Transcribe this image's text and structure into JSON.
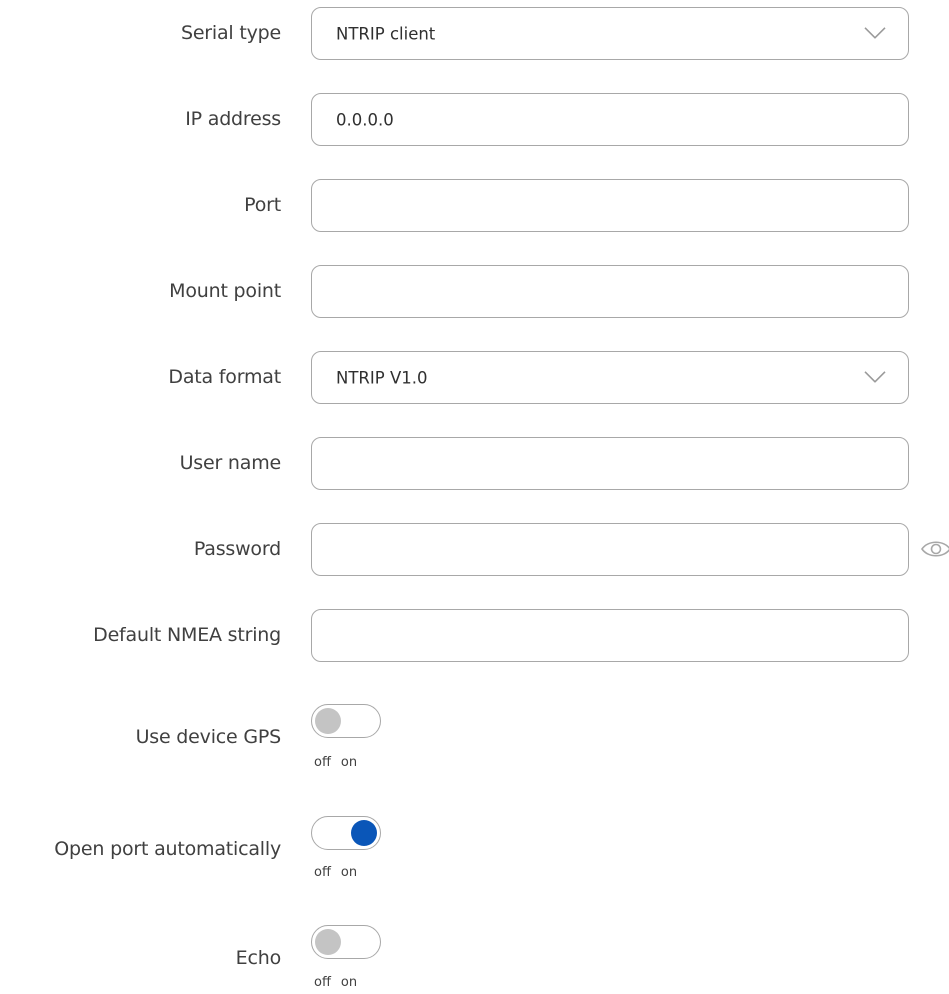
{
  "form": {
    "serial_type": {
      "label": "Serial type",
      "value": "NTRIP client"
    },
    "ip_address": {
      "label": "IP address",
      "value": "0.0.0.0"
    },
    "port": {
      "label": "Port",
      "value": ""
    },
    "mount_point": {
      "label": "Mount point",
      "value": ""
    },
    "data_format": {
      "label": "Data format",
      "value": "NTRIP V1.0"
    },
    "user_name": {
      "label": "User name",
      "value": ""
    },
    "password": {
      "label": "Password",
      "value": ""
    },
    "default_nmea": {
      "label": "Default NMEA string",
      "value": ""
    },
    "use_device_gps": {
      "label": "Use device GPS",
      "state": "off",
      "off_label": "off",
      "on_label": "on"
    },
    "open_port_automatically": {
      "label": "Open port automatically",
      "state": "on",
      "off_label": "off",
      "on_label": "on"
    },
    "echo": {
      "label": "Echo",
      "state": "off",
      "off_label": "off",
      "on_label": "on"
    }
  },
  "colors": {
    "toggle_on": "#0a56b8",
    "toggle_off_knob": "#c4c4c4",
    "border": "#a8a8a8",
    "text": "#404040"
  },
  "icons": {
    "select_arrow": "chevron-down-icon",
    "password_reveal": "eye-icon"
  }
}
